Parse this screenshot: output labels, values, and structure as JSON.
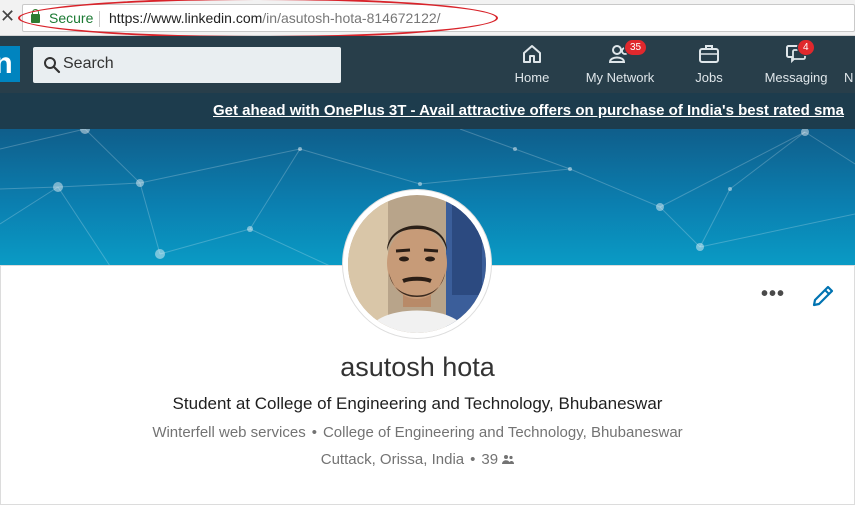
{
  "browser": {
    "close_glyph": "✕",
    "secure_label": "Secure",
    "url_host": "https://www.linkedin.com",
    "url_path": "/in/asutosh-hota-814672122/"
  },
  "nav": {
    "logo": "in",
    "search_placeholder": "Search",
    "items": [
      {
        "label": "Home",
        "icon": "home-icon",
        "badge": ""
      },
      {
        "label": "My Network",
        "icon": "network-icon",
        "badge": "35"
      },
      {
        "label": "Jobs",
        "icon": "briefcase-icon",
        "badge": ""
      },
      {
        "label": "Messaging",
        "icon": "messaging-icon",
        "badge": "4"
      },
      {
        "label": "N",
        "icon": "notifications-icon",
        "badge": ""
      }
    ]
  },
  "promo": {
    "text": "Get ahead with OnePlus 3T - Avail attractive offers on purchase of India's best rated sma"
  },
  "profile": {
    "name": "asutosh hota",
    "headline": "Student at College of Engineering and Technology, Bhubaneswar",
    "company": "Winterfell web services",
    "school": "College of Engineering and Technology, Bhubaneswar",
    "location": "Cuttack, Orissa, India",
    "connections": "39",
    "more_glyph": "•••"
  },
  "colors": {
    "navbar": "#283e4a",
    "brand": "#0084bf",
    "badge": "#e0282d",
    "annotation": "#d8232a"
  }
}
